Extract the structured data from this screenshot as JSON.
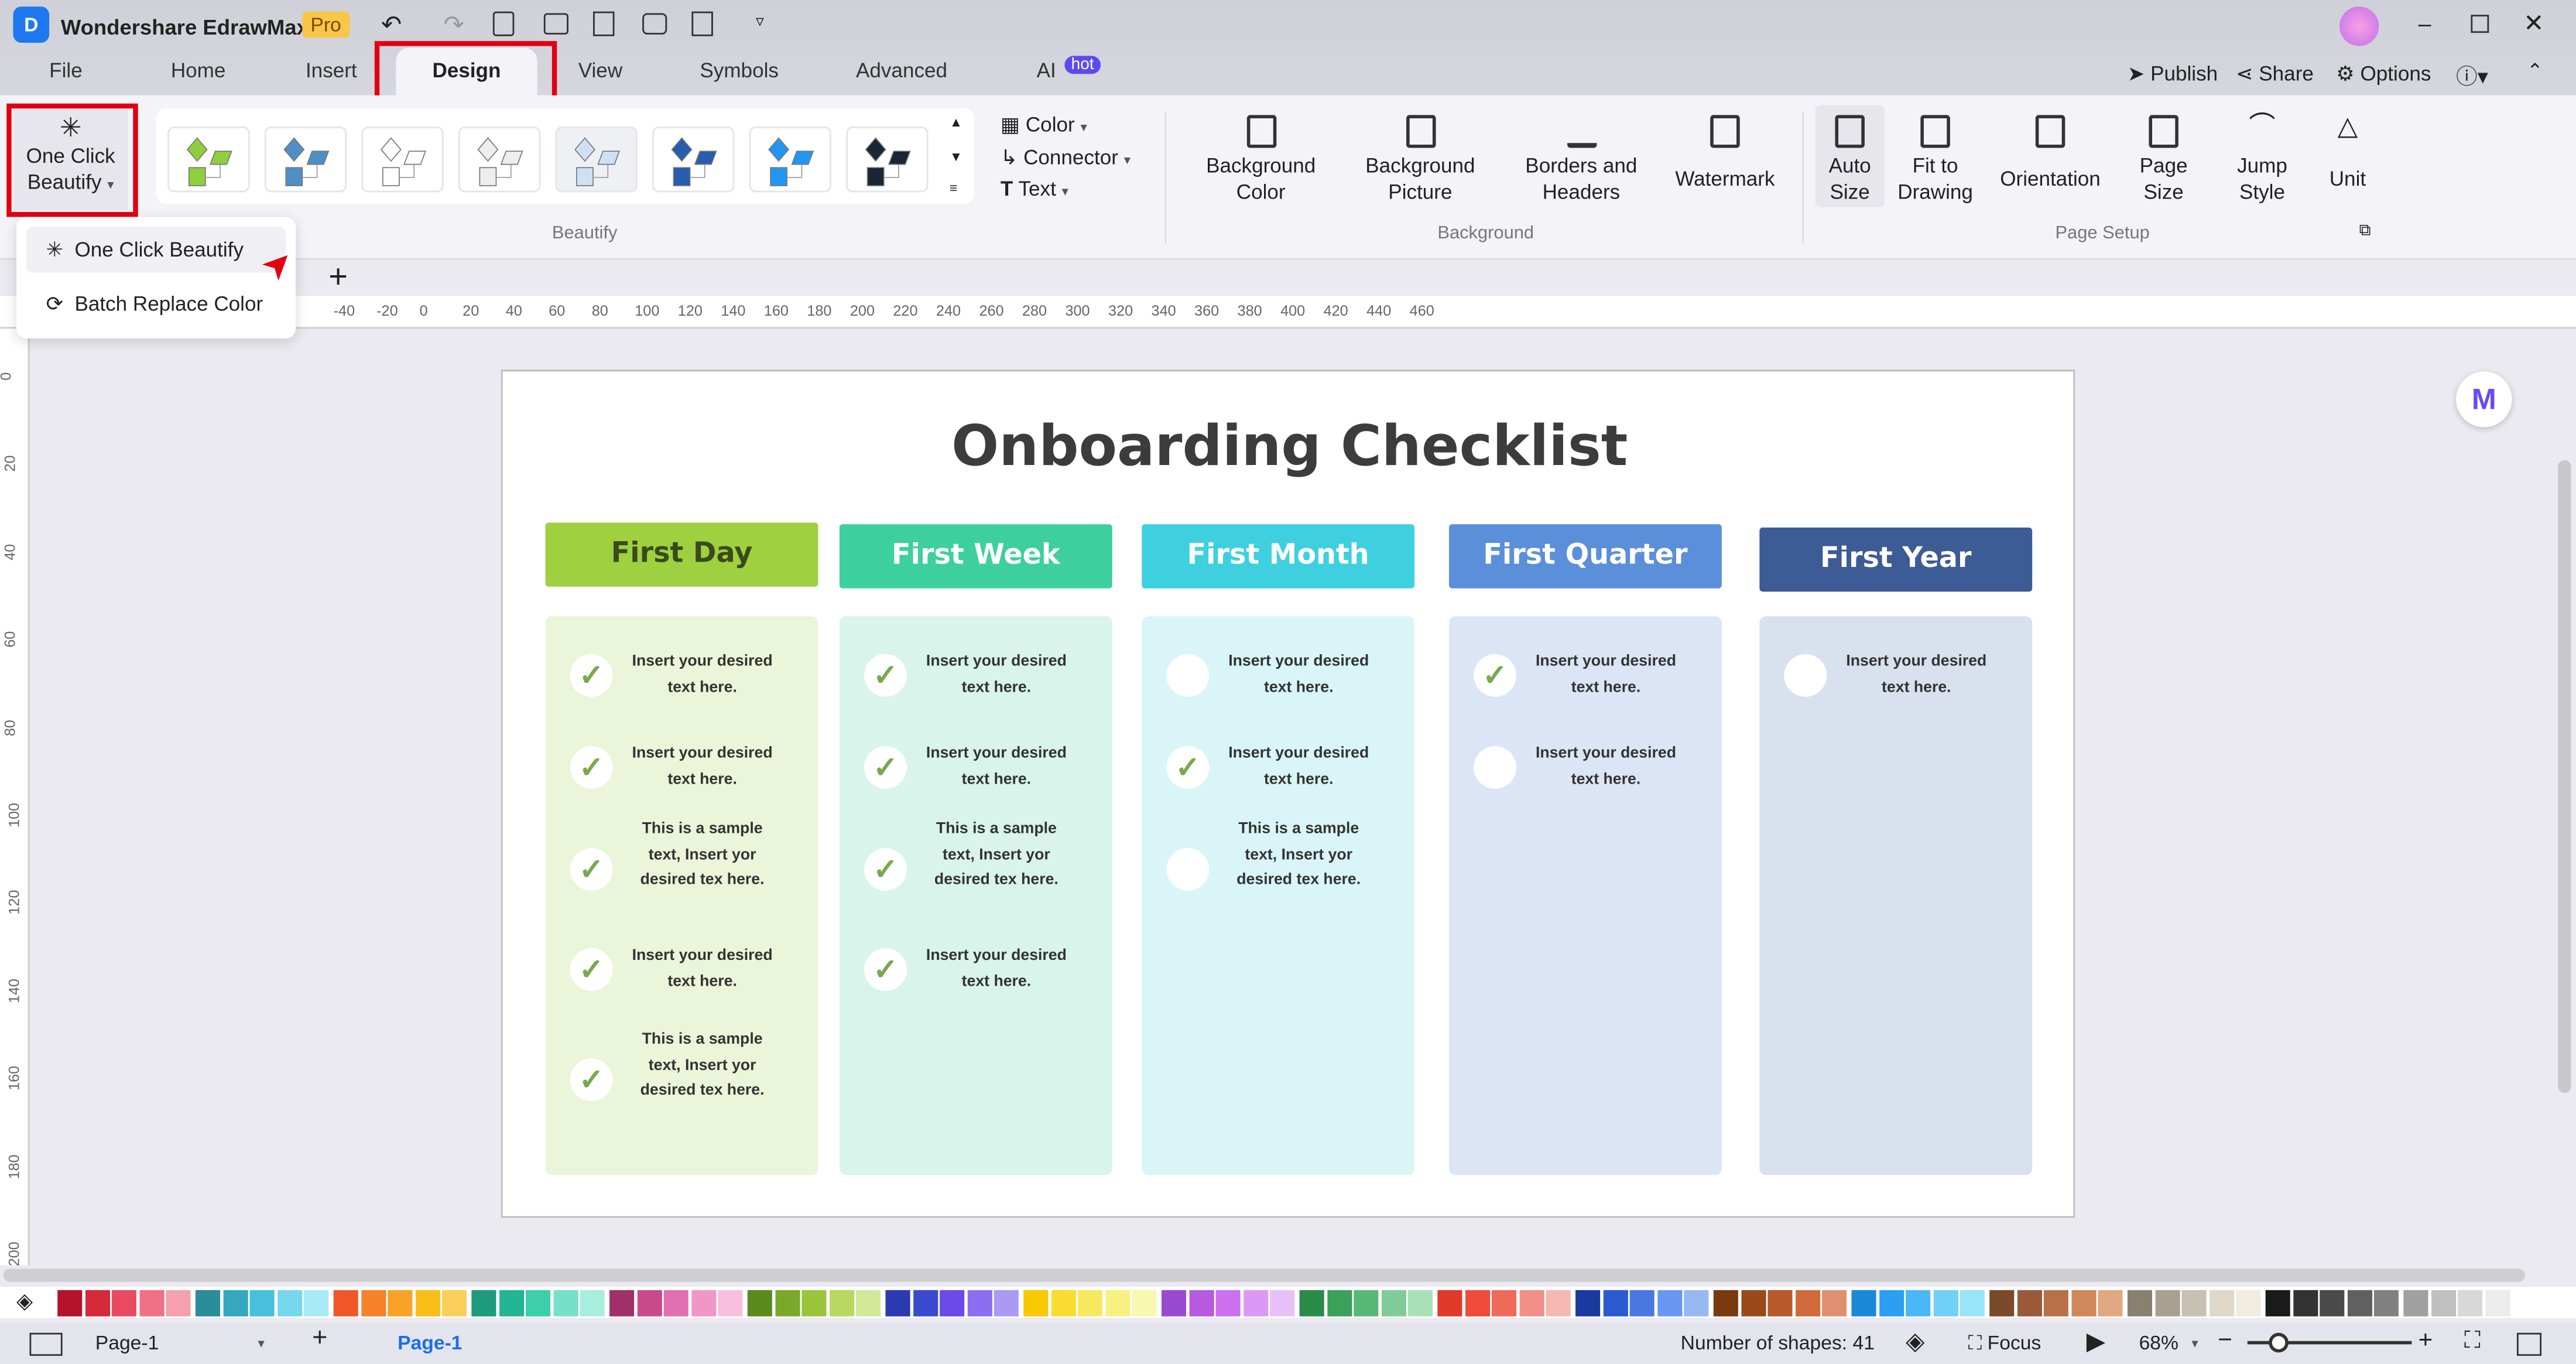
{
  "app": {
    "title": "Wondershare EdrawMax",
    "badge": "Pro"
  },
  "menu_tabs": [
    {
      "label": "File"
    },
    {
      "label": "Home"
    },
    {
      "label": "Insert"
    },
    {
      "label": "Design"
    },
    {
      "label": "View"
    },
    {
      "label": "Symbols"
    },
    {
      "label": "Advanced"
    },
    {
      "label": "AI"
    }
  ],
  "ai_badge": "hot",
  "right_actions": {
    "publish": "Publish",
    "share": "Share",
    "options": "Options"
  },
  "ribbon": {
    "one_click_beautify": "One Click Beautify",
    "beautify_group": "Beautify",
    "color": "Color",
    "connector": "Connector",
    "text": "Text",
    "background_color": "Background Color",
    "background_picture": "Background Picture",
    "borders_headers": "Borders and Headers",
    "watermark": "Watermark",
    "background_group": "Background",
    "auto_size": "Auto Size",
    "fit_to_drawing": "Fit to Drawing",
    "orientation": "Orientation",
    "page_size": "Page Size",
    "jump_style": "Jump Style",
    "unit": "Unit",
    "page_setup_group": "Page Setup",
    "theme_colors": [
      "#8fcf3c",
      "#4f8fc6",
      "#ffffff",
      "#eeeeee",
      "#cfe0f5",
      "#2a5cad",
      "#2196f3",
      "#1a2633"
    ]
  },
  "dropdown": {
    "items": [
      {
        "label": "One Click Beautify"
      },
      {
        "label": "Batch Replace Color"
      }
    ]
  },
  "ruler": {
    "h_labels": [
      "-40",
      "-20",
      "0",
      "20",
      "40",
      "60",
      "80",
      "100",
      "120",
      "140",
      "160",
      "180",
      "200",
      "220",
      "240",
      "260",
      "280",
      "300",
      "320",
      "340",
      "360",
      "380",
      "400",
      "420",
      "440",
      "460"
    ],
    "v_labels": [
      "0",
      "20",
      "40",
      "60",
      "80",
      "100",
      "120",
      "140",
      "160",
      "180",
      "200"
    ]
  },
  "diagram": {
    "title": "Onboarding Checklist",
    "columns": [
      {
        "header": "First Day",
        "color": "#9fd040",
        "bg": "#ebf5d9",
        "items": [
          {
            "text": "Insert your desired text here.",
            "checked": true
          },
          {
            "text": "Insert your desired text here.",
            "checked": true
          },
          {
            "text": "This is a sample text, Insert yor desired tex here.",
            "checked": true
          },
          {
            "text": "Insert your desired text here.",
            "checked": true
          },
          {
            "text": "This is a sample text, Insert yor desired tex here.",
            "checked": true
          }
        ]
      },
      {
        "header": "First Week",
        "color": "#3ecf9f",
        "bg": "#d9f4ea",
        "items": [
          {
            "text": "Insert your desired text here.",
            "checked": true
          },
          {
            "text": "Insert your desired text here.",
            "checked": true
          },
          {
            "text": "This is a sample text, Insert yor desired tex here.",
            "checked": true
          },
          {
            "text": "Insert your desired text here.",
            "checked": true
          }
        ]
      },
      {
        "header": "First Month",
        "color": "#3fd0df",
        "bg": "#d9f5f7",
        "items": [
          {
            "text": "Insert your desired text here.",
            "checked": false
          },
          {
            "text": "Insert your desired text here.",
            "checked": true
          },
          {
            "text": "This is a sample text, Insert yor desired tex here.",
            "checked": false
          }
        ]
      },
      {
        "header": "First Quarter",
        "color": "#5b8fda",
        "bg": "#dbe5f6",
        "items": [
          {
            "text": "Insert your desired text here.",
            "checked": true
          },
          {
            "text": "Insert your desired text here.",
            "checked": false
          }
        ]
      },
      {
        "header": "First Year",
        "color": "#3d5b94",
        "bg": "#d9e1ef",
        "items": [
          {
            "text": "Insert your desired text here.",
            "checked": false
          }
        ]
      }
    ]
  },
  "palette": [
    "#b5132b",
    "#d42a3a",
    "#e84a62",
    "#f07085",
    "#f5a0ac",
    "#2b8c9a",
    "#35a8c0",
    "#48c0dc",
    "#75d8ec",
    "#a8eaf6",
    "#f0582a",
    "#f5822a",
    "#f9a22a",
    "#fbbd1a",
    "#f9cf5a",
    "#1e9a7d",
    "#22b594",
    "#3ccfaa",
    "#78e0c6",
    "#a8eedc",
    "#a0306a",
    "#c84a8a",
    "#e070b0",
    "#f096c8",
    "#f8c0dc",
    "#5a8a1e",
    "#7aa82a",
    "#9ac43a",
    "#b8d860",
    "#d4e89a",
    "#2a3ab0",
    "#3a4ad0",
    "#6a4ae8",
    "#8a70f0",
    "#aa9af4",
    "#f8c800",
    "#f8dc30",
    "#f8e860",
    "#f8f080",
    "#f8f8b0",
    "#9a4ad0",
    "#b85ae0",
    "#cc70f0",
    "#dc98f4",
    "#e8c0f8",
    "#2a8a4a",
    "#3aa05a",
    "#58b878",
    "#80cc98",
    "#a8e0b8",
    "#e03a2a",
    "#f04a3a",
    "#f06a5a",
    "#f09088",
    "#f4b8b0",
    "#1a3aa0",
    "#2a5ad0",
    "#4a78e0",
    "#6a98f0",
    "#98b8f4",
    "#7a3a10",
    "#9a4a1a",
    "#b85a2a",
    "#d06a3a",
    "#e09070",
    "#1a8ad8",
    "#2aa0f0",
    "#4ab8f8",
    "#70d0f8",
    "#98e4f8",
    "#7a4a2a",
    "#9a5a3a",
    "#b8704a",
    "#d0885a",
    "#e0a880",
    "#8a8070",
    "#a8a090",
    "#c8c0b0",
    "#e0d8c8",
    "#f0ece0",
    "#1a1a1a",
    "#333333",
    "#4a4a4a",
    "#606060",
    "#808080",
    "#a0a0a0",
    "#c0c0c0",
    "#d8d8d8",
    "#ececec",
    "#ffffff"
  ],
  "status": {
    "page_selector": "Page-1",
    "active_page": "Page-1",
    "shape_count": "Number of shapes: 41",
    "focus": "Focus",
    "zoom": "68%"
  }
}
